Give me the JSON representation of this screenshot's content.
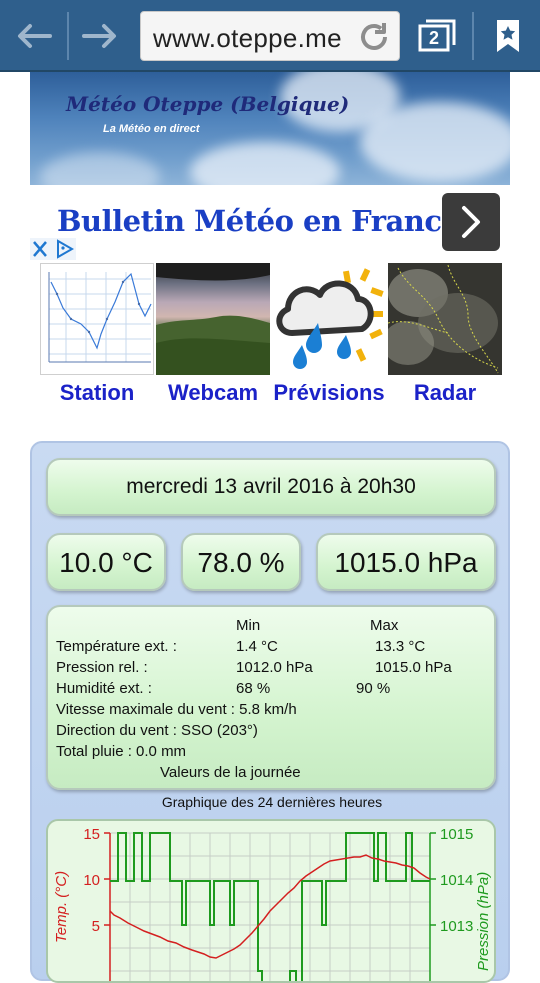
{
  "browser": {
    "url": "www.oteppe.me",
    "tab_count": "2"
  },
  "banner": {
    "title": "Météo Oteppe (Belgique)",
    "subtitle": "La Météo en direct"
  },
  "ad": {
    "text": "Bulletin Météo en France »"
  },
  "nav": {
    "items": [
      {
        "label": "Station"
      },
      {
        "label": "Webcam"
      },
      {
        "label": "Prévisions"
      },
      {
        "label": "Radar"
      }
    ]
  },
  "weather": {
    "datetime": "mercredi 13 avril 2016 à 20h30",
    "temperature": "10.0 °C",
    "humidity": "78.0 %",
    "pressure": "1015.0 hPa",
    "stats": {
      "col_min": "Min",
      "col_max": "Max",
      "temp_label": "Température ext. :",
      "temp_min": "1.4 °C",
      "temp_max": "13.3 °C",
      "press_label": "Pression rel. :",
      "press_min": "1012.0 hPa",
      "press_max": "1015.0 hPa",
      "hum_label": "Humidité ext. :",
      "hum_min": "68 %",
      "hum_max": "90 %",
      "wind_max": "Vitesse maximale du vent : 5.8 km/h",
      "wind_dir": "Direction du vent : SSO (203°)",
      "rain": "Total pluie : 0.0 mm",
      "footer": "Valeurs de la journée"
    },
    "graph_title": "Graphique des 24 dernières heures",
    "graph": {
      "ylabel_left": "Temp. (°C)",
      "ylabel_right": "Pression (hPa)",
      "left_ticks": [
        "15",
        "10",
        "5"
      ],
      "right_ticks": [
        "1015",
        "1014",
        "1013"
      ],
      "temp_color": "#d42020",
      "press_color": "#1e9a1e"
    }
  }
}
